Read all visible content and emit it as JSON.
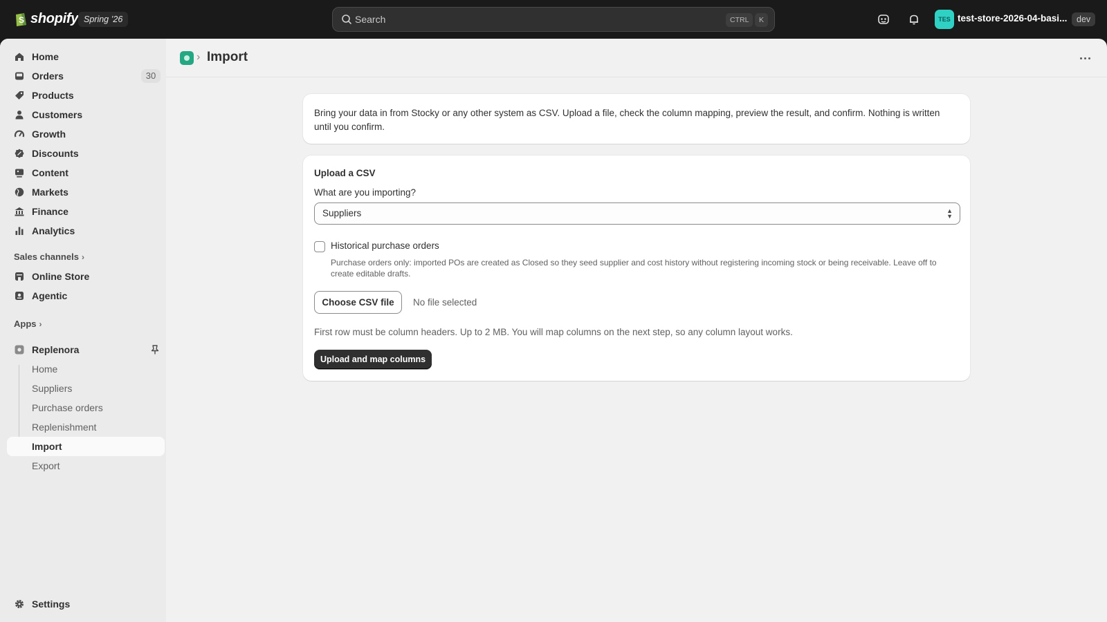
{
  "topbar": {
    "brand": "shopify",
    "edition": "Spring ’26",
    "search_placeholder": "Search",
    "shortcut_ctrl": "CTRL",
    "shortcut_key": "K",
    "avatar_initials": "TES",
    "store_name": "test-store-2026-04-basi...",
    "env_badge": "dev"
  },
  "sidebar": {
    "nav": [
      {
        "label": "Home",
        "icon": "home-icon"
      },
      {
        "label": "Orders",
        "icon": "inbox-icon",
        "badge": "30"
      },
      {
        "label": "Products",
        "icon": "tag-icon"
      },
      {
        "label": "Customers",
        "icon": "person-icon"
      },
      {
        "label": "Growth",
        "icon": "gauge-icon"
      },
      {
        "label": "Discounts",
        "icon": "discount-icon"
      },
      {
        "label": "Content",
        "icon": "image-icon"
      },
      {
        "label": "Markets",
        "icon": "globe-icon"
      },
      {
        "label": "Finance",
        "icon": "bank-icon"
      },
      {
        "label": "Analytics",
        "icon": "bar-chart-icon"
      }
    ],
    "sales_channels_label": "Sales channels",
    "channels": [
      {
        "label": "Online Store",
        "icon": "store-icon"
      },
      {
        "label": "Agentic",
        "icon": "agent-icon"
      }
    ],
    "apps_label": "Apps",
    "app": {
      "name": "Replenora",
      "items": [
        "Home",
        "Suppliers",
        "Purchase orders",
        "Replenishment",
        "Import",
        "Export"
      ],
      "active": "Import"
    },
    "settings_label": "Settings"
  },
  "page": {
    "title": "Import",
    "intro": "Bring your data in from Stocky or any other system as CSV. Upload a file, check the column mapping, preview the result, and confirm. Nothing is written until you confirm.",
    "upload": {
      "title": "Upload a CSV",
      "select_label": "What are you importing?",
      "select_value": "Suppliers",
      "checkbox_label": "Historical purchase orders",
      "checkbox_checked": false,
      "checkbox_help": "Purchase orders only: imported POs are created as Closed so they seed supplier and cost history without registering incoming stock or being receivable. Leave off to create editable drafts.",
      "file_button": "Choose CSV file",
      "file_status": "No file selected",
      "rules": "First row must be column headers. Up to 2 MB. You will map columns on the next step, so any column layout works.",
      "submit_button": "Upload and map columns"
    }
  },
  "colors": {
    "topbar_bg": "#1a1a1a",
    "frame_bg": "#f1f1f1",
    "sidebar_bg": "#ebebeb",
    "primary_button": "#303030",
    "avatar_bg": "#2ed1c4",
    "app_icon": "#23a883"
  }
}
